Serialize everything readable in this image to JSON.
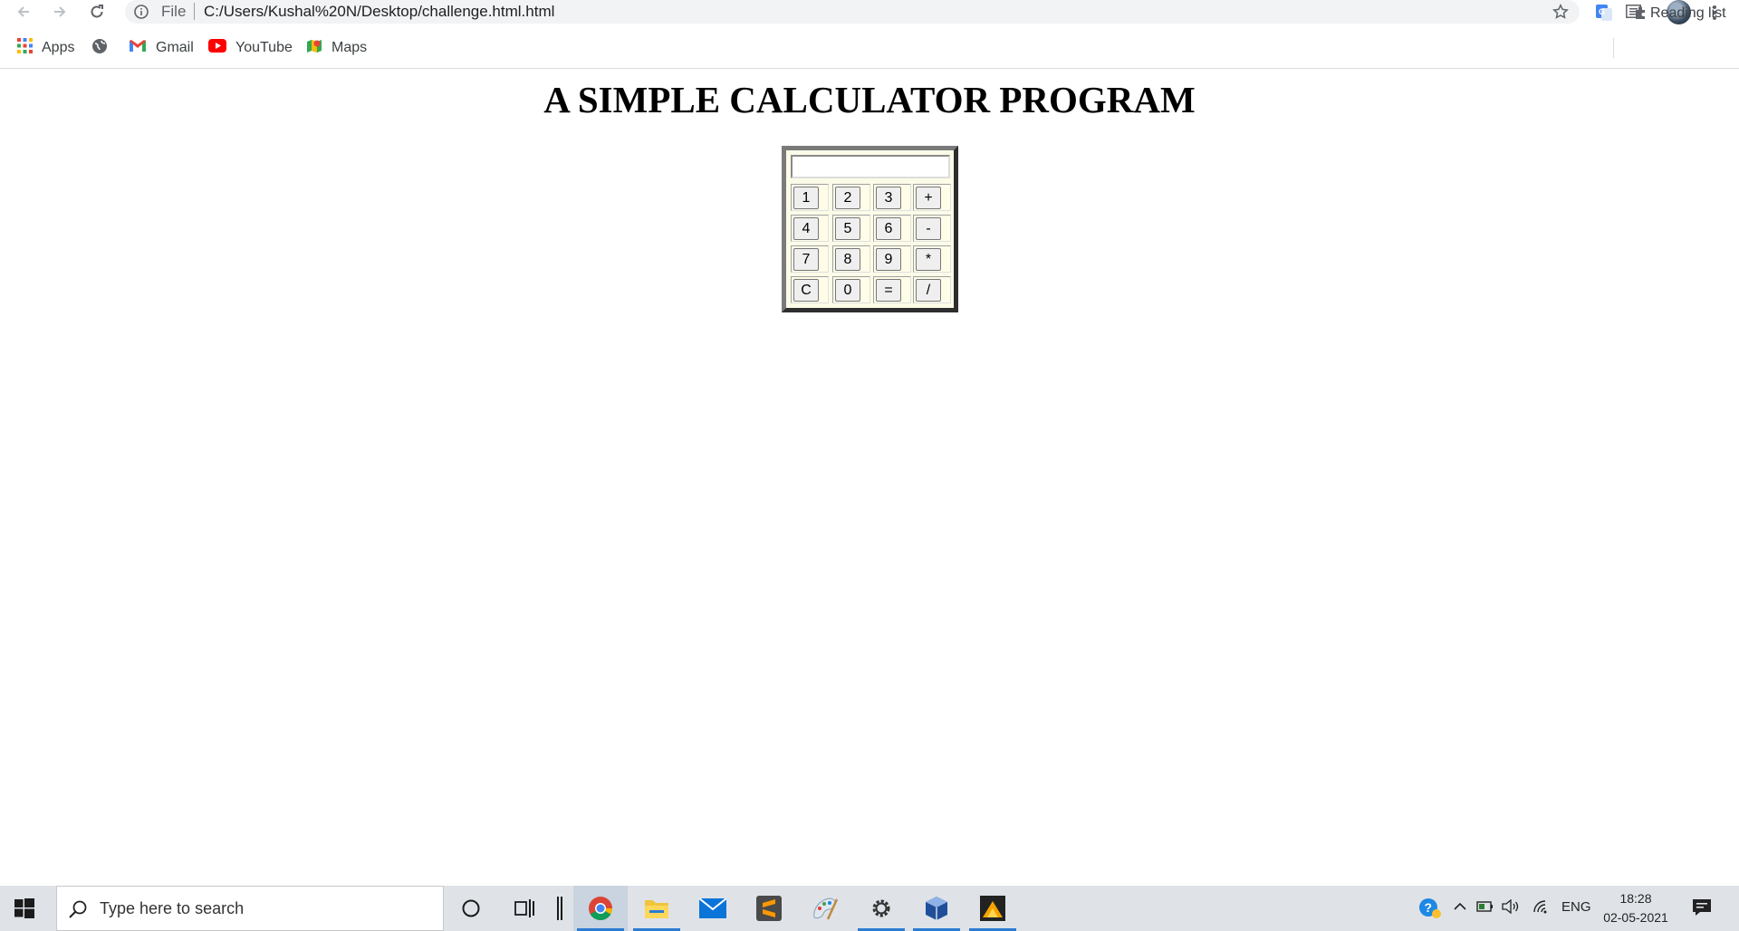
{
  "browser": {
    "omnibox_scheme": "File",
    "url": "C:/Users/Kushal%20N/Desktop/challenge.html.html"
  },
  "bookmarks": [
    {
      "label": "Apps",
      "icon": "apps-grid-icon"
    },
    {
      "label": "",
      "icon": "globe-icon"
    },
    {
      "label": "Gmail",
      "icon": "gmail-icon"
    },
    {
      "label": "YouTube",
      "icon": "youtube-icon"
    },
    {
      "label": "Maps",
      "icon": "maps-icon"
    }
  ],
  "reading_list": "Reading list",
  "page": {
    "title": "A SIMPLE CALCULATOR PROGRAM",
    "display_value": "",
    "keys": [
      [
        "1",
        "2",
        "3",
        "+"
      ],
      [
        "4",
        "5",
        "6",
        "-"
      ],
      [
        "7",
        "8",
        "9",
        "*"
      ],
      [
        "C",
        "0",
        "=",
        "/"
      ]
    ]
  },
  "taskbar": {
    "search_placeholder": "Type here to search",
    "language": "ENG",
    "time": "18:28",
    "date": "02-05-2021"
  }
}
